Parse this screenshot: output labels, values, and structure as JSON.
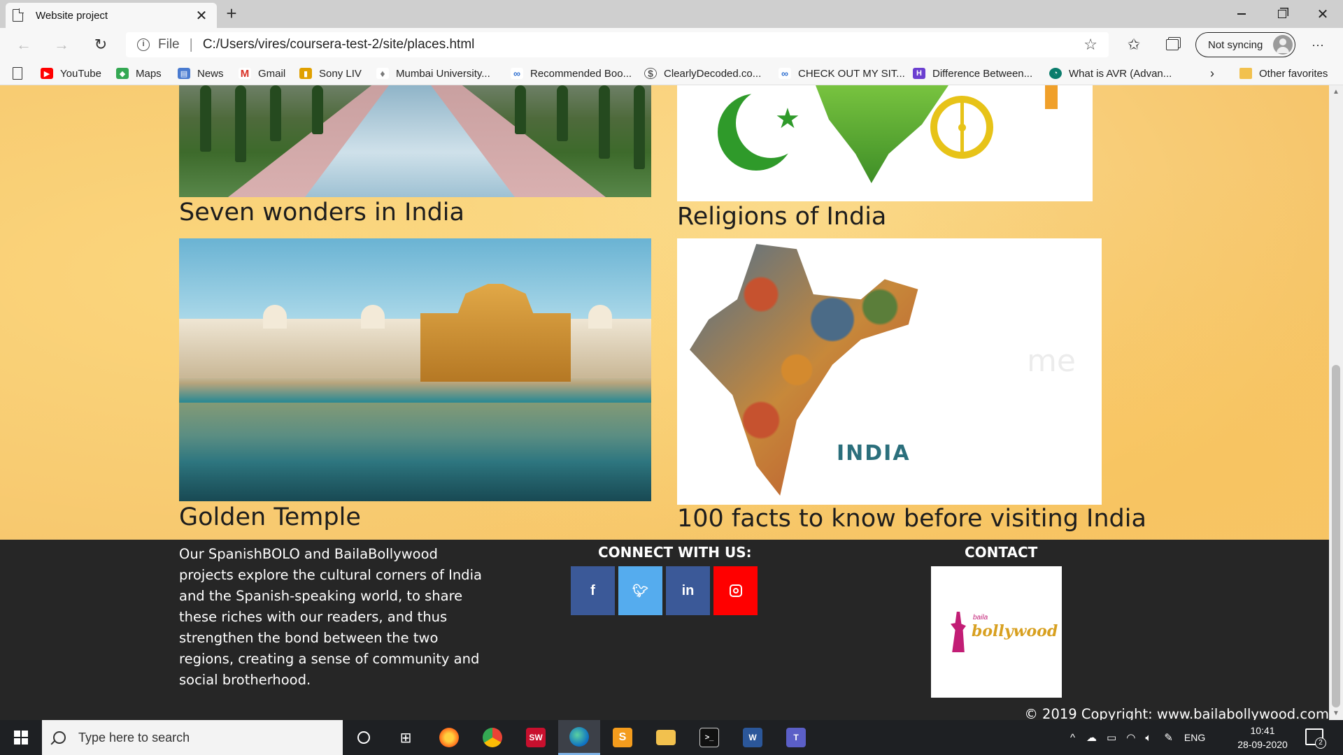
{
  "browser": {
    "tab_title": "Website project",
    "tab_close": "✕",
    "new_tab": "+",
    "address": {
      "scheme_label": "File",
      "url": "C:/Users/vires/coursera-test-2/site/places.html"
    },
    "sync_label": "Not syncing",
    "more_label": "···",
    "bookmarks": [
      {
        "label": "YouTube",
        "icon": "youtube-icon",
        "color": "#ff0000"
      },
      {
        "label": "Maps",
        "icon": "maps-icon",
        "color": "#34a853"
      },
      {
        "label": "News",
        "icon": "news-icon",
        "color": "#4a7bd0"
      },
      {
        "label": "Gmail",
        "icon": "gmail-icon",
        "color": "#d93025"
      },
      {
        "label": "Sony LIV",
        "icon": "sonyliv-icon",
        "color": "#e0a000"
      },
      {
        "label": "Mumbai University...",
        "icon": "university-icon",
        "color": "#7a7a7a"
      },
      {
        "label": "Recommended Boo...",
        "icon": "link-icon",
        "color": "#2f6fd0"
      },
      {
        "label": "ClearlyDecoded.co...",
        "icon": "site-icon",
        "color": "#555555"
      },
      {
        "label": "CHECK OUT MY SIT...",
        "icon": "link-icon",
        "color": "#2f6fd0"
      },
      {
        "label": "Difference Between...",
        "icon": "site-icon",
        "color": "#6b3fd0"
      },
      {
        "label": "What is AVR (Advan...",
        "icon": "site-icon",
        "color": "#0a7c6c"
      }
    ],
    "other_favorites": "Other favorites"
  },
  "page": {
    "cards": [
      {
        "title": "Seven wonders in India",
        "image": "taj-mahal-garden-image"
      },
      {
        "title": "Religions of India",
        "image": "religions-symbols-image"
      },
      {
        "title": "Golden Temple",
        "image": "golden-temple-image"
      },
      {
        "title": "100 facts to know before visiting India",
        "image": "india-culture-map-image"
      }
    ],
    "map_word": "INDIA"
  },
  "footer": {
    "about": "Our SpanishBOLO and BailaBollywood projects explore the cultural corners of India and the Spanish-speaking world, to share these riches with our readers, and thus strengthen the bond between the two regions, creating a sense of community and social brotherhood.",
    "connect_heading": "CONNECT WITH US:",
    "social": [
      {
        "label": "f",
        "name": "facebook",
        "color": "#3b5998"
      },
      {
        "label": "t",
        "name": "twitter",
        "color": "#55acee"
      },
      {
        "label": "in",
        "name": "linkedin",
        "color": "#3b5998"
      },
      {
        "label": "ig",
        "name": "instagram",
        "color": "#ff0000"
      }
    ],
    "contact_heading": "CONTACT",
    "logo_small": "baila",
    "logo_text": "bollywood",
    "copyright": "© 2019 Copyright: www.bailabollywood.com"
  },
  "taskbar": {
    "search_placeholder": "Type here to search",
    "language": "ENG",
    "time": "10:41",
    "date": "28-09-2020",
    "notification_count": "2"
  }
}
